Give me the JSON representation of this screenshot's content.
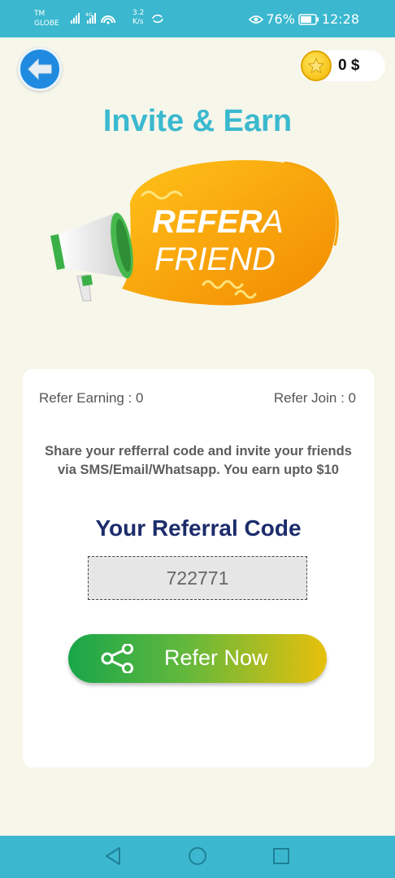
{
  "status_bar": {
    "carrier_line1": "TM",
    "carrier_line2": "GLOBE",
    "network_speed_value": "3.2",
    "network_speed_unit": "K/s",
    "battery": "76%",
    "time": "12:28"
  },
  "header": {
    "back_icon": "arrow-left-icon",
    "coin_icon": "star-coin-icon",
    "coin_balance": "0 $"
  },
  "page_title": "Invite & Earn",
  "hero": {
    "line1_bold": "REFER",
    "line1_light": "A",
    "line2": "FRIEND",
    "icon": "megaphone-icon"
  },
  "card": {
    "refer_earning": "Refer Earning : 0",
    "refer_join": "Refer Join : 0",
    "description": "Share your refferral code and invite your friends via SMS/Email/Whatsapp. You earn upto $10",
    "code_heading": "Your Referral Code",
    "referral_code": "722771",
    "refer_button_label": "Refer Now",
    "refer_button_icon": "share-icon"
  },
  "colors": {
    "accent": "#3bb8cf",
    "heading": "#1c2c6b",
    "button_start": "#19a64a",
    "button_end": "#e8c00c"
  },
  "nav_bar": {
    "items": [
      "back-triangle-icon",
      "home-circle-icon",
      "recents-square-icon"
    ]
  }
}
